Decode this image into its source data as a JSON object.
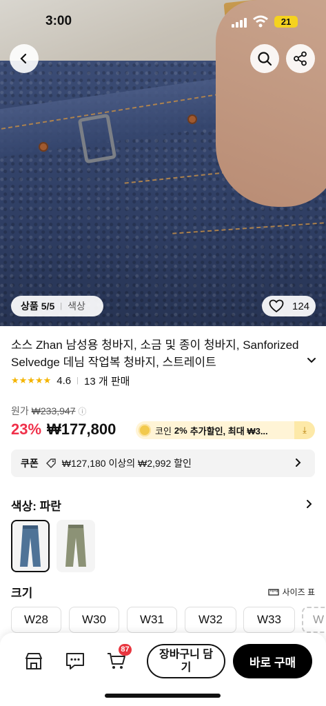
{
  "status_bar": {
    "time": "3:00",
    "battery": "21"
  },
  "gallery": {
    "counter_label": "상품",
    "counter": "5/5",
    "separator": "|",
    "tag": "색상",
    "like_count": "124"
  },
  "product": {
    "title": "소스 Zhan 남성용 청바지, 소금 및 종이 청바지, Sanforized Selvedge 데님 작업복 청바지, 스트레이트",
    "rating": "4.6",
    "sold": "13 개 판매",
    "original_label": "원가",
    "original_price": "₩233,947",
    "discount": "23%",
    "price": "₩177,800",
    "coin_text": "코인",
    "coin_pct": "2%",
    "coin_rest": "추가할인, 최대 ₩3..."
  },
  "coupon": {
    "label": "쿠폰",
    "text": "₩127,180 이상의 ₩2,992 할인"
  },
  "color": {
    "heading": "색상: 파란",
    "options": [
      "blue",
      "khaki"
    ]
  },
  "size": {
    "heading": "크기",
    "guide": "사이즈 표",
    "options": [
      "W28",
      "W30",
      "W31",
      "W32",
      "W33",
      "W"
    ]
  },
  "bottom": {
    "cart_badge": "87",
    "add_to_cart": "장바구니 담기",
    "buy": "바로 구매"
  },
  "icons": [
    "back-icon",
    "search-icon",
    "share-icon",
    "heart-icon",
    "store-icon",
    "chat-icon",
    "cart-icon",
    "ruler-icon"
  ]
}
